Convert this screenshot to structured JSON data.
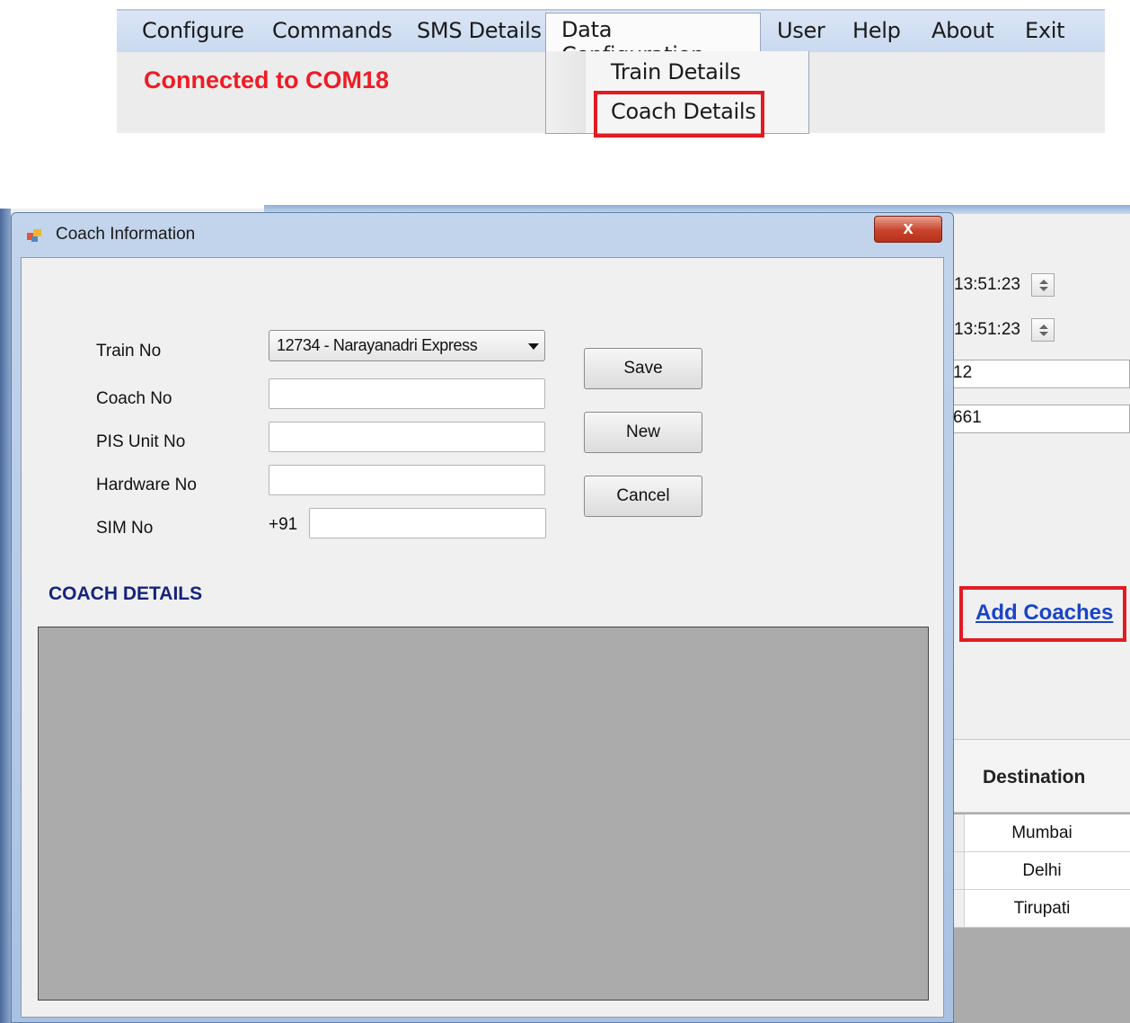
{
  "menubar": {
    "items": [
      "Configure",
      "Commands",
      "SMS Details",
      "Data Configuration",
      "User",
      "Help",
      "About",
      "Exit"
    ],
    "open_menu": "Data Configuration",
    "dropdown_items": [
      "Train Details",
      "Coach Details"
    ],
    "highlighted_item": "Coach Details"
  },
  "status": {
    "connected_text": "Connected to COM18",
    "color": "#ee1c24"
  },
  "background_window": {
    "time_start": "13:51:23",
    "time_end": "13:51:23",
    "field_one": "12",
    "field_two": "661",
    "add_coaches_link": "Add Coaches",
    "grid_header": "Destination",
    "grid_rows": [
      "Mumbai",
      "Delhi",
      "Tirupati"
    ]
  },
  "dialog": {
    "title": "Coach Information",
    "close_label": "x",
    "labels": {
      "train_no": "Train No",
      "coach_no": "Coach No",
      "pis_unit_no": "PIS Unit No",
      "hardware_no": "Hardware No",
      "sim_no": "SIM No"
    },
    "train_selected": "12734 - Narayanadri Express",
    "sim_prefix": "+91",
    "values": {
      "coach_no": "",
      "pis_unit_no": "",
      "hardware_no": "",
      "sim_no": ""
    },
    "buttons": {
      "save": "Save",
      "new": "New",
      "cancel": "Cancel"
    },
    "section_title": "COACH DETAILS"
  },
  "colors": {
    "highlight": "#e21b23",
    "link": "#1a44c8",
    "section_title": "#14247a"
  }
}
